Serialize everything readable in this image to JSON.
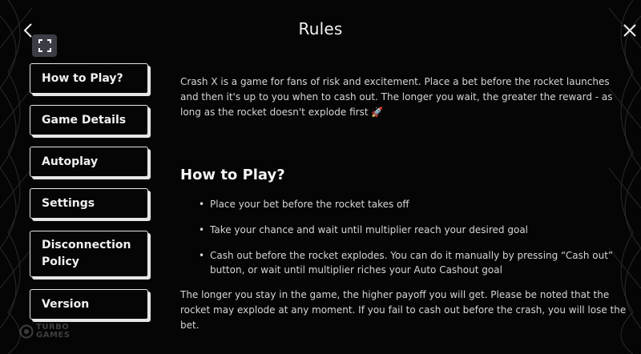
{
  "header": {
    "title": "Rules"
  },
  "icons": {
    "back": "chevron-left-icon",
    "close": "close-icon",
    "fullscreen": "fullscreen-icon"
  },
  "sidebar": {
    "items": [
      {
        "label": "How to Play?"
      },
      {
        "label": "Game Details"
      },
      {
        "label": "Autoplay"
      },
      {
        "label": "Settings"
      },
      {
        "label": "Disconnection Policy"
      },
      {
        "label": "Version"
      }
    ]
  },
  "content": {
    "intro": "Crash X is a game for fans of risk and excitement. Place a bet before the rocket launches and then it's up to you when to cash out. The longer you wait, the greater the reward - as long as the rocket doesn't explode first 🚀",
    "section_title": "How to Play?",
    "steps": [
      "Place your bet before the rocket takes off",
      "Take your chance and wait until multiplier reach your desired goal",
      "Cash out before the rocket explodes. You can do it manually by pressing “Cash out” button, or wait until multiplier riches your Auto Cashout goal"
    ],
    "outro": "The longer you stay in the game, the higher payoff you will get. Please be noted that the rocket may explode at any moment. If you fail to cash out before the crash, you will lose the bet."
  },
  "brand": {
    "line1": "TURBO",
    "line2": "GAMES"
  },
  "colors": {
    "background": "#050505",
    "text": "#e9e9e9",
    "button_border": "#e6e6e6",
    "fullscreen_bg": "#3a3d44"
  }
}
